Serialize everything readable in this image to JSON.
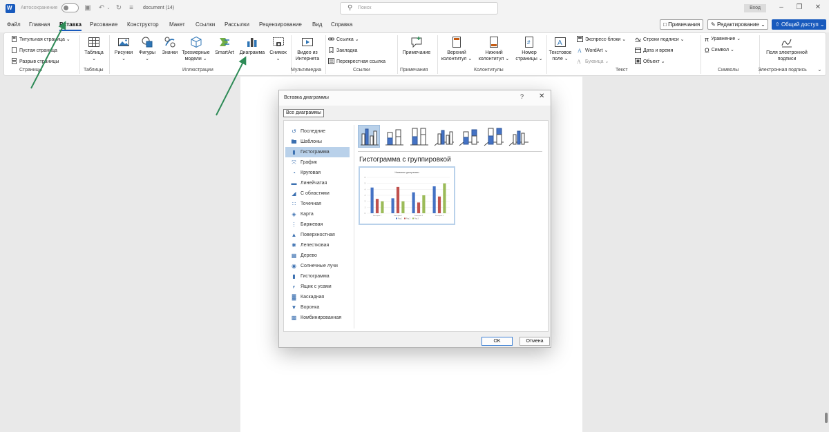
{
  "titlebar": {
    "autosave_label": "Автосохранение",
    "doc_name": "document (14)",
    "search_placeholder": "Поиск",
    "signin_label": "Вход"
  },
  "menu": {
    "tabs": [
      "Файл",
      "Главная",
      "Вставка",
      "Рисование",
      "Конструктор",
      "Макет",
      "Ссылки",
      "Рассылки",
      "Рецензирование",
      "Вид",
      "Справка"
    ],
    "active_tab": "Вставка",
    "comments_label": "Примечания",
    "editing_label": "Редактирование",
    "share_label": "Общий доступ"
  },
  "ribbon": {
    "pages": {
      "cover": "Титульная страница",
      "blank": "Пустая страница",
      "break": "Разрыв страницы",
      "label": "Страницы"
    },
    "tables": {
      "table": "Таблица",
      "label": "Таблицы"
    },
    "illustrations": {
      "pictures": "Рисунки",
      "shapes": "Фигуры",
      "icons": "Значки",
      "models": [
        "Трехмерные",
        "модели"
      ],
      "smartart": "SmartArt",
      "chart": "Диаграмма",
      "screenshot": "Снимок",
      "label": "Иллюстрации"
    },
    "media": {
      "video": [
        "Видео из",
        "Интернета"
      ],
      "label": "Мультимедиа"
    },
    "links": {
      "link": "Ссылка",
      "bookmark": "Закладка",
      "crossref": "Перекрестная ссылка",
      "label": "Ссылки"
    },
    "comments": {
      "comment": "Примечание",
      "label": "Примечания"
    },
    "header_footer": {
      "header": [
        "Верхний",
        "колонтитул"
      ],
      "footer": [
        "Нижний",
        "колонтитул"
      ],
      "page_number": [
        "Номер",
        "страницы"
      ],
      "label": "Колонтитулы"
    },
    "text": {
      "textbox": [
        "Текстовое",
        "поле"
      ],
      "quick_parts": "Экспресс-блоки",
      "wordart": "WordArt",
      "dropcap": "Буквица",
      "signature_line": "Строки подписи",
      "datetime": "Дата и время",
      "object": "Объект",
      "label": "Текст"
    },
    "symbols": {
      "equation": "Уравнение",
      "symbol": "Символ",
      "label": "Символы"
    },
    "esign": {
      "field": [
        "Поля электронной",
        "подписи"
      ],
      "label": "Электронная подпись"
    }
  },
  "dialog": {
    "title": "Вставка диаграммы",
    "help": "?",
    "tab": "Все диаграммы",
    "types": [
      {
        "label": "Последние",
        "icon": "recent-icon"
      },
      {
        "label": "Шаблоны",
        "icon": "folder-icon"
      },
      {
        "label": "Гистограмма",
        "icon": "column-chart-icon"
      },
      {
        "label": "График",
        "icon": "line-chart-icon"
      },
      {
        "label": "Круговая",
        "icon": "pie-chart-icon"
      },
      {
        "label": "Линейчатая",
        "icon": "bar-chart-icon"
      },
      {
        "label": "С областями",
        "icon": "area-chart-icon"
      },
      {
        "label": "Точечная",
        "icon": "scatter-chart-icon"
      },
      {
        "label": "Карта",
        "icon": "map-chart-icon"
      },
      {
        "label": "Биржевая",
        "icon": "stock-chart-icon"
      },
      {
        "label": "Поверхностная",
        "icon": "surface-chart-icon"
      },
      {
        "label": "Лепестковая",
        "icon": "radar-chart-icon"
      },
      {
        "label": "Дерево",
        "icon": "treemap-chart-icon"
      },
      {
        "label": "Солнечные лучи",
        "icon": "sunburst-chart-icon"
      },
      {
        "label": "Гистограмма",
        "icon": "histogram-chart-icon"
      },
      {
        "label": "Ящик с усами",
        "icon": "boxwhisker-chart-icon"
      },
      {
        "label": "Каскадная",
        "icon": "waterfall-chart-icon"
      },
      {
        "label": "Воронка",
        "icon": "funnel-chart-icon"
      },
      {
        "label": "Комбинированная",
        "icon": "combo-chart-icon"
      }
    ],
    "selected_type": "Гистограмма",
    "subtype_title": "Гистограмма с группировкой",
    "ok_label": "OK",
    "cancel_label": "Отмена"
  },
  "colors": {
    "brand_blue": "#185abd",
    "selection": "#b9d1ea",
    "arrow_green": "#2e8b57",
    "series_blue": "#4472c4",
    "series_red": "#c0504d",
    "series_green": "#9bbb59"
  },
  "chart_data": {
    "type": "bar",
    "categories": [
      "Категория 1",
      "Категория 2",
      "Категория 3",
      "Категория 4"
    ],
    "series": [
      {
        "name": "Ряд 1",
        "values": [
          4.3,
          2.5,
          3.5,
          4.5
        ]
      },
      {
        "name": "Ряд 2",
        "values": [
          2.4,
          4.4,
          1.8,
          2.8
        ]
      },
      {
        "name": "Ряд 3",
        "values": [
          2.0,
          2.0,
          3.0,
          5.0
        ]
      }
    ],
    "title": "Название диаграммы",
    "ylim": [
      0,
      6
    ],
    "yticks": [
      "0",
      "1",
      "2",
      "3",
      "4",
      "5",
      "6"
    ],
    "grid": true,
    "legend": "bottom"
  }
}
